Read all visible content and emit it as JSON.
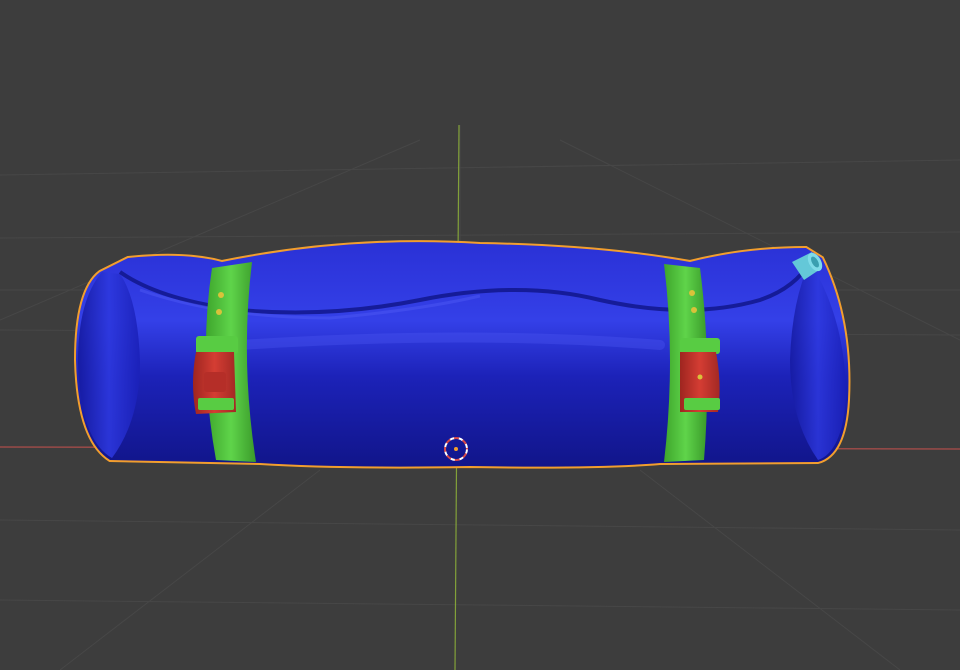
{
  "viewport": {
    "background": "#3d3d3d",
    "grid_line_color": "#474747",
    "x_axis_color": "#c0504d",
    "y_axis_color": "#8fb339",
    "icons": [
      "3d-cursor-icon",
      "origin-dot-icon"
    ]
  },
  "object": {
    "selected": true,
    "outline_color": "#f29e2e",
    "parts": {
      "roll_body": "#1f26c9",
      "straps": "#4fc23b",
      "buckles": "#c9342b",
      "valve": "#64c8d8"
    }
  }
}
